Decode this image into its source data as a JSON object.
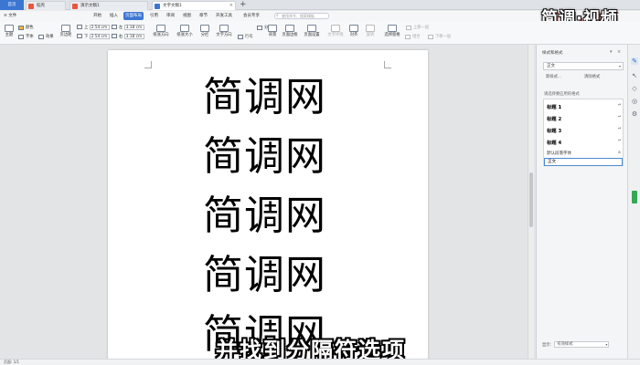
{
  "tabs": {
    "home": "首页",
    "items": [
      {
        "label": "稻壳",
        "color": "#e8563f"
      },
      {
        "label": "演示文稿1",
        "color": "#e8563f"
      },
      {
        "label": "文字文稿1",
        "color": "#3b76d2"
      }
    ],
    "new_tab": "+"
  },
  "logo": "简调·视频",
  "menu": {
    "file": "≡ 文件",
    "items": [
      "开始",
      "插入",
      "页面布局",
      "引用",
      "审阅",
      "视图",
      "章节",
      "开发工具",
      "会员专享"
    ],
    "active": "页面布局",
    "search_placeholder": "查找命令、搜索模板"
  },
  "ribbon": {
    "theme": "主题",
    "colors": "颜色",
    "fonts": "字体",
    "effects": "效果",
    "margins": "页边距",
    "top_label": "上",
    "top_value": "2.54 cm",
    "bottom_label": "下",
    "bottom_value": "2.54 cm",
    "left_label": "左",
    "left_value": "3.18 cm",
    "right_label": "右",
    "right_value": "3.18 cm",
    "orientation": "纸张方向",
    "size": "纸张大小",
    "columns": "分栏",
    "text_direction": "文字方向",
    "line_number": "行号",
    "breaks": "分隔符",
    "background": "背景",
    "page_border": "页面边框",
    "page_setup": "页面设置",
    "text_wrap": "文字环绕",
    "align": "对齐",
    "rotate": "旋转",
    "select_pane": "选择窗格",
    "group": "组合",
    "bring_forward": "上移一层",
    "send_backward": "下移一层"
  },
  "document": {
    "lines": [
      "简调网",
      "简调网",
      "简调网",
      "简调网",
      "简调网"
    ]
  },
  "subtitle": "并找到分隔符选项",
  "style_pane": {
    "title": "样式和格式",
    "current_style": "正文",
    "new_style": "新样式...",
    "clear_format": "清除格式",
    "hint": "请选择要应用的格式",
    "styles": [
      {
        "label": "标题 1",
        "ret": "↵"
      },
      {
        "label": "标题 2",
        "ret": "↵"
      },
      {
        "label": "标题 3",
        "ret": "↵"
      },
      {
        "label": "标题 4",
        "ret": "↵"
      }
    ],
    "default_para": "默认段落字体",
    "default_para_mark": "a",
    "selected": "正文",
    "footer_label": "显示:",
    "footer_value": "有效样式"
  },
  "status": "页面: 1/1"
}
